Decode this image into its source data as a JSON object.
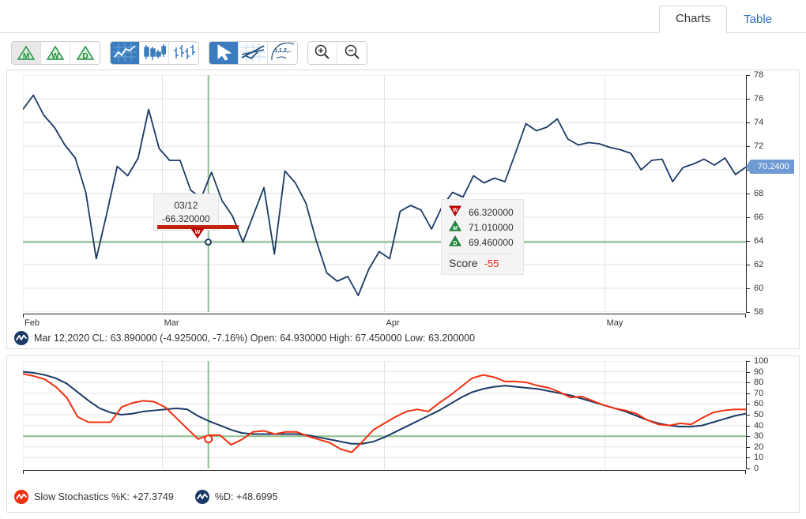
{
  "tabs": [
    {
      "label": "Charts",
      "active": true
    },
    {
      "label": "Table",
      "active": false
    }
  ],
  "toolbar": {
    "period_buttons": [
      {
        "name": "monthly",
        "letter": "M",
        "selected": true
      },
      {
        "name": "weekly",
        "letter": "W",
        "selected": false
      },
      {
        "name": "daily",
        "letter": "D",
        "selected": false
      }
    ],
    "charttype_buttons": [
      {
        "name": "line-chart",
        "selected": true
      },
      {
        "name": "candlestick-chart",
        "selected": false
      },
      {
        "name": "ohlc-bar-chart",
        "selected": false
      }
    ],
    "tool_buttons": [
      {
        "name": "cursor-tool",
        "selected": true
      },
      {
        "name": "trendline-tool",
        "selected": false
      },
      {
        "name": "fibonacci-tool",
        "selected": false
      }
    ],
    "zoom_buttons": [
      {
        "name": "zoom-in",
        "glyph": "+"
      },
      {
        "name": "zoom-out",
        "glyph": "−"
      }
    ]
  },
  "price_flag": {
    "value": "70.2400",
    "color": "#6f9ad3"
  },
  "tooltip": {
    "date": "03/12",
    "value": "-66.320000",
    "bar_color": "#c0220d"
  },
  "legend": {
    "rows": [
      {
        "icon": "weekly-down-triangle-icon",
        "direction": "down",
        "letter": "W",
        "color": "#cc0000",
        "value": "66.320000"
      },
      {
        "icon": "monthly-up-triangle-icon",
        "direction": "up",
        "letter": "M",
        "color": "#1e8f3e",
        "value": "71.010000"
      },
      {
        "icon": "daily-up-triangle-icon",
        "direction": "up",
        "letter": "D",
        "color": "#1e8f3e",
        "value": "69.460000"
      }
    ],
    "score_label": "Score",
    "score_value": "-55",
    "score_color": "#e02b10"
  },
  "price_status": {
    "icon": "navy-wave-icon",
    "icon_color": "#1b3a66",
    "text": "Mar 12,2020 CL: 63.890000 (-4.925000, -7.16%) Open: 64.930000 High: 67.450000 Low: 63.200000"
  },
  "stoch_status": {
    "items": [
      {
        "icon": "red-wave-icon",
        "icon_color": "#f03010",
        "text": "Slow Stochastics %K: +27.3749"
      },
      {
        "icon": "navy-wave-icon",
        "icon_color": "#1b3a66",
        "text": "%D: +48.6995"
      }
    ]
  },
  "chart_data": [
    {
      "type": "line",
      "title": "Price",
      "xlabel": "",
      "ylabel": "",
      "ylim": [
        58,
        78
      ],
      "yticks": [
        58,
        60,
        62,
        64,
        66,
        68,
        70,
        72,
        74,
        76,
        78
      ],
      "grid": true,
      "legend_position": "none",
      "xtick_labels": [
        "Feb",
        "Mar",
        "Apr",
        "May"
      ],
      "xtick_positions": [
        0,
        22,
        65,
        108
      ],
      "series": [
        {
          "name": "Close",
          "color": "#1b3a66",
          "values": [
            75.1,
            76.3,
            74.6,
            73.6,
            72.1,
            71.0,
            68.1,
            62.5,
            66.3,
            70.3,
            69.5,
            71.0,
            75.1,
            71.8,
            70.8,
            70.8,
            68.3,
            67.6,
            69.8,
            67.4,
            66.1,
            63.9,
            66.2,
            68.5,
            62.9,
            69.9,
            68.9,
            67.2,
            64.0,
            61.3,
            60.6,
            61.0,
            59.4,
            61.6,
            63.1,
            62.5,
            66.5,
            67.0,
            66.6,
            65.0,
            66.9,
            68.1,
            67.7,
            69.5,
            68.9,
            69.3,
            69.0,
            71.4,
            73.9,
            73.3,
            73.6,
            74.3,
            72.6,
            72.1,
            72.3,
            72.2,
            71.9,
            71.7,
            71.4,
            70.0,
            70.8,
            70.9,
            69.0,
            70.2,
            70.5,
            70.9,
            70.4,
            71.0,
            69.6,
            70.24
          ]
        }
      ],
      "markers": {
        "crosshair_x_value": "03/12",
        "crosshair_y_value": 63.9,
        "crosshair_color": "#8dbf8d"
      }
    },
    {
      "type": "line",
      "title": "Slow Stochastics",
      "xlabel": "",
      "ylabel": "",
      "ylim": [
        0,
        100
      ],
      "yticks": [
        0,
        10,
        20,
        30,
        40,
        50,
        60,
        70,
        80,
        90,
        100
      ],
      "grid": true,
      "legend_position": "below",
      "series": [
        {
          "name": "%K",
          "color": "#f03010",
          "values": [
            88,
            86,
            83,
            76,
            66,
            48,
            43,
            43,
            43,
            57,
            61,
            63,
            62,
            57,
            47,
            37,
            27.37,
            31,
            31,
            22,
            27,
            34,
            35,
            32,
            34,
            34,
            30,
            27,
            24,
            18,
            15,
            25,
            36,
            42,
            48,
            53,
            55,
            53,
            61,
            68,
            76,
            84,
            87,
            85,
            81,
            81,
            80,
            77,
            75,
            71,
            66,
            67,
            63,
            59,
            56,
            54,
            51,
            45,
            41,
            40,
            42,
            41,
            47,
            52,
            54,
            55,
            55
          ]
        },
        {
          "name": "%D",
          "color": "#1b3a66",
          "values": [
            90,
            89,
            87,
            84,
            79,
            71,
            63,
            56,
            52,
            50,
            51,
            53,
            54,
            55,
            56,
            55,
            48.7,
            44,
            40,
            36,
            33,
            32,
            32,
            32,
            32,
            32,
            31,
            29,
            27,
            25,
            23,
            23,
            25,
            29,
            34,
            39,
            44,
            49,
            54,
            60,
            66,
            71,
            74,
            76,
            77,
            76,
            75,
            74,
            72,
            70,
            68,
            65,
            62,
            59,
            56,
            53,
            49,
            45,
            42,
            40,
            39,
            39,
            40,
            43,
            46,
            49,
            51
          ]
        }
      ],
      "markers": {
        "crosshair_y_value": 30,
        "crosshair_color": "#8dbf8d"
      }
    }
  ]
}
